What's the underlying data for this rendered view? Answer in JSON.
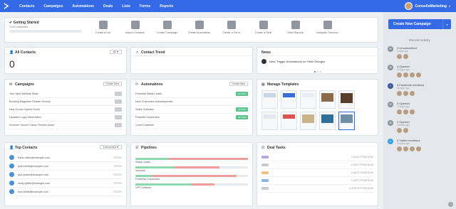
{
  "nav": {
    "items": [
      "Contacts",
      "Campaigns",
      "Automations",
      "Deals",
      "Lists",
      "Forms",
      "Reports"
    ],
    "account": "ConseilsMarketing"
  },
  "getting_started": {
    "title": "Getting Started",
    "subtitle": "0 of 8 completed",
    "actions": [
      "Create a List",
      "Import Contacts",
      "Create Campaign",
      "Create Automation",
      "Create a Form",
      "Create a Deal",
      "View Reports",
      "Integrate Services"
    ]
  },
  "all_contacts": {
    "title": "All Contacts",
    "count": "0",
    "filter": "All"
  },
  "contact_trend": {
    "title": "Contact Trend"
  },
  "news": {
    "title": "News",
    "item": "New: Trigger Automations on Field Changes"
  },
  "campaigns": {
    "title": "Campaigns",
    "button": "Create New",
    "rows": [
      "Your April Website Stats",
      "Booking Magazine Reader Survey",
      "New Condo Opens Soon!",
      "Updated Login Information",
      "Summer Soccer Camp Preview Issue"
    ]
  },
  "automations": {
    "title": "Automations",
    "button": "Create New",
    "rows": [
      {
        "name": "Potential Sales Leads",
        "status": "ACTIVE"
      },
      {
        "name": "New Customers Autoresponder",
        "status": ""
      },
      {
        "name": "Sales Outreach",
        "status": "ACTIVE"
      },
      {
        "name": "Possible Customers",
        "status": "ACTIVE"
      },
      {
        "name": "Covid Outreach",
        "status": ""
      }
    ]
  },
  "manage_templates": {
    "title": "Manage Templates"
  },
  "top_contacts": {
    "title": "Top Contacts",
    "filter": "Interaction",
    "rows": [
      "frank.miller@example.com",
      "julia.smith@example.com",
      "jack.jones@example.com",
      "molly.griffin@example.com",
      "nick.bellis@example.com"
    ]
  },
  "pipelines": {
    "title": "Pipelines",
    "rows": [
      {
        "name": "Sales Leads",
        "green": 0.3,
        "red": 0.7
      },
      {
        "name": "Vendors",
        "green": 0.35,
        "red": 0.4
      },
      {
        "name": "Potential Customers",
        "green": 0.15,
        "red": 0.75
      },
      {
        "name": "VIP Contacts",
        "green": 0.5,
        "red": 0.2
      }
    ]
  },
  "deal_tasks": {
    "title": "Deal Tasks",
    "rows": [
      {
        "color": "#b7a6e0",
        "due": "3 DAYS FROM NOW"
      },
      {
        "color": "#c6cbd2",
        "due": "3 DAYS FROM NOW"
      },
      {
        "color": "#f4c27a",
        "due": "4 DAYS FROM NOW"
      },
      {
        "color": "#8ab7e8",
        "due": "3 DAYS FROM NOW"
      },
      {
        "color": "#c6cbd2",
        "due": "4 MONTH FROM NOW"
      }
    ]
  },
  "sidebar": {
    "create_button": "Create New Campaign",
    "recent_title": "Recent Activity",
    "feed": [
      {
        "icon": "unsubscribe-icon",
        "text": "3 Unsubscribed",
        "ago": "3 days ago",
        "avatars": 2
      },
      {
        "icon": "email-open-icon",
        "text": "4 Opened",
        "ago": "22 days ago",
        "avatars": 4
      },
      {
        "icon": "facebook-icon",
        "text": "3 Facebook mentions",
        "ago": "22 days ago",
        "avatars": 3
      },
      {
        "icon": "email-open-icon",
        "text": "3 Opened",
        "ago": "22 days ago",
        "avatars": 3
      },
      {
        "icon": "email-open-icon",
        "text": "2 Opened",
        "ago": "3 weeks ago",
        "avatars": 2
      },
      {
        "icon": "twitter-icon",
        "text": "4 Twitter mentions",
        "ago": "3 weeks ago",
        "avatars": 4
      }
    ]
  }
}
